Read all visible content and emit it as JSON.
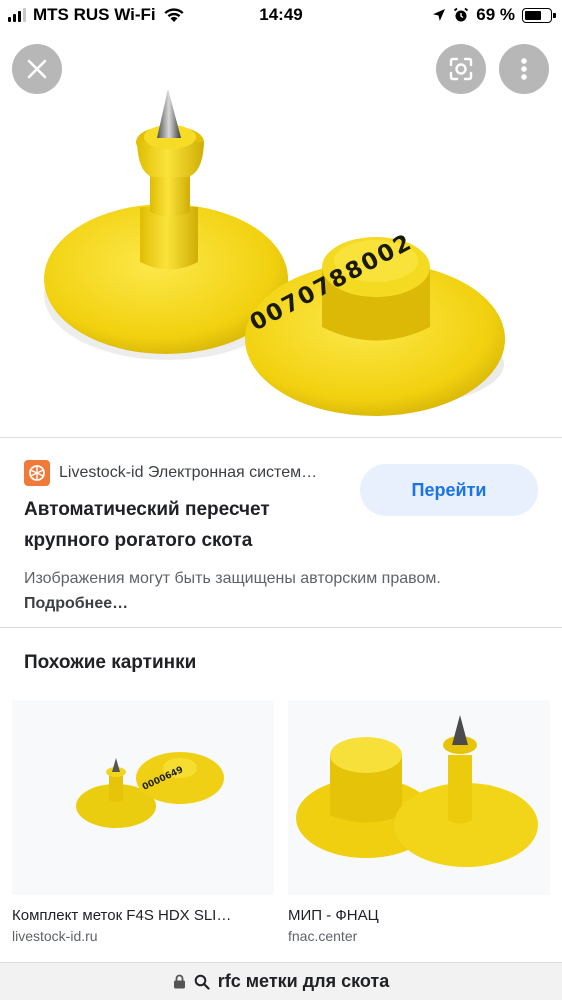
{
  "status_bar": {
    "carrier": "MTS RUS Wi-Fi",
    "time": "14:49",
    "battery_text": "69 %",
    "battery_level": 0.69
  },
  "hero": {
    "close_icon": "close-icon",
    "lens_icon": "lens-icon",
    "more_icon": "more-vert-icon",
    "tag_number": "0070788002"
  },
  "result": {
    "source": "Livestock-id Электронная систем…",
    "title": "Автоматический пересчет крупного рогатого скота",
    "visit_button": "Перейти",
    "copyright": "Изображения могут быть защищены авторским правом.",
    "more_link": "Подробнее…"
  },
  "similar": {
    "heading": "Похожие картинки",
    "items": [
      {
        "caption": "Комплект меток F4S HDX SLI…",
        "domain": "livestock-id.ru"
      },
      {
        "caption": "МИП - ФНАЦ",
        "domain": "fnac.center"
      }
    ]
  },
  "url_bar": {
    "text": "rfc метки для скота"
  },
  "colors": {
    "accent": "#1a73e8",
    "button_bg": "#e8f0fe",
    "tag_yellow": "#f4d40c",
    "overlay_button": "#b7b7b7"
  }
}
